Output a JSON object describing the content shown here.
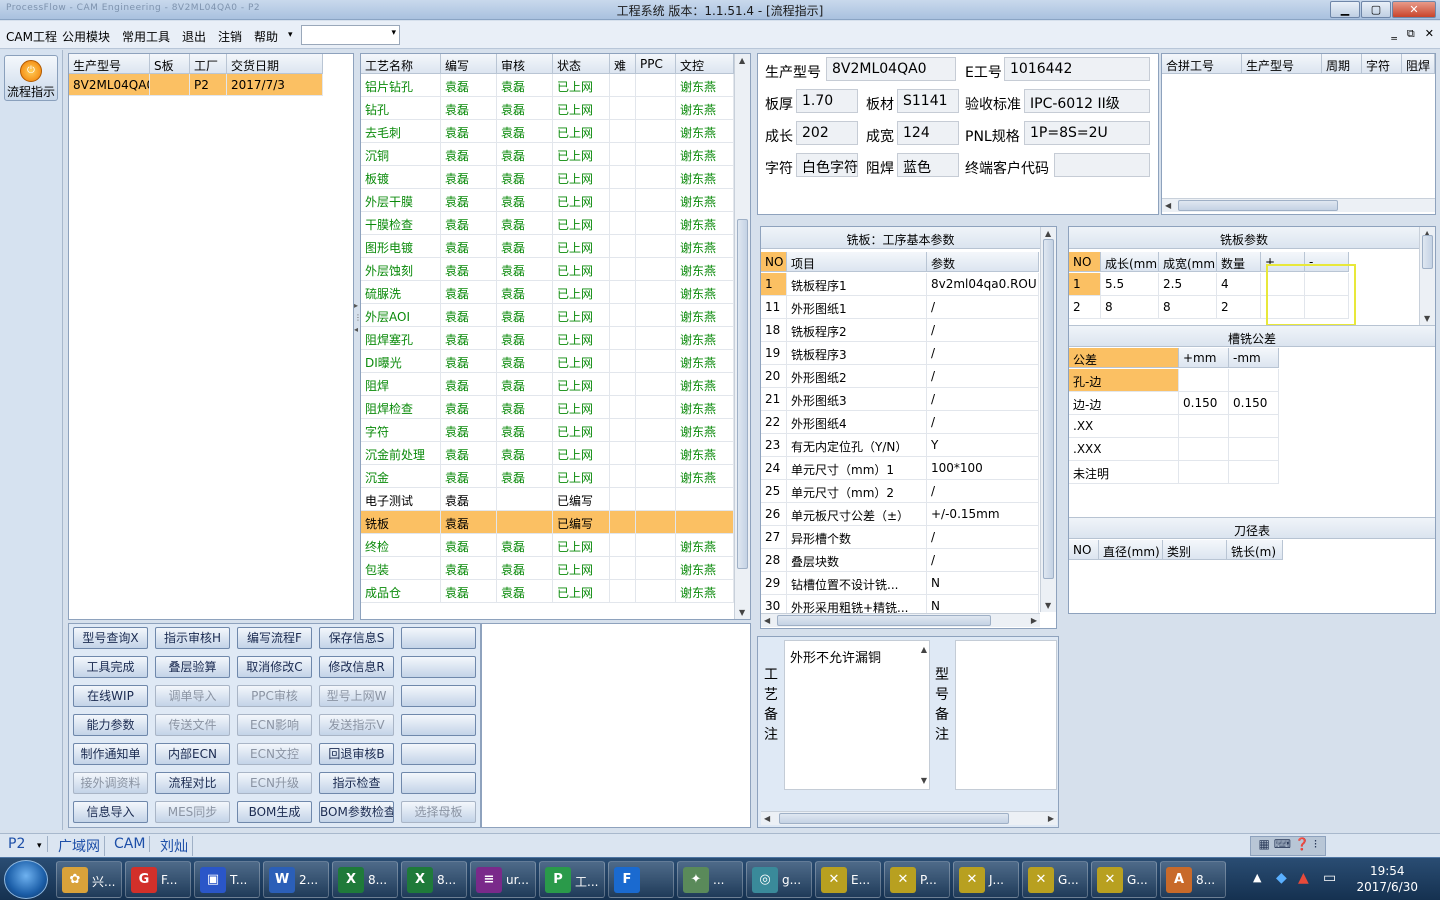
{
  "window": {
    "title": "工程系统   版本：1.1.51.4 - [流程指示]",
    "ghost_title": "ProcessFlow - CAM Engineering - 8V2ML04QA0 - P2"
  },
  "menu": {
    "items": [
      "CAM工程",
      "公用模块",
      "常用工具",
      "退出",
      "注销",
      "帮助"
    ],
    "combo_value": ""
  },
  "side": {
    "flow_button": "流程指示"
  },
  "model_list": {
    "headers": [
      "生产型号",
      "S板",
      "工厂",
      "交货日期"
    ],
    "rows": [
      [
        "8V2ML04QA0",
        "",
        "P2",
        "2017/7/3"
      ]
    ]
  },
  "process": {
    "headers": [
      "工艺名称",
      "编写",
      "审核",
      "状态",
      "难",
      "PPC",
      "文控"
    ],
    "rows": [
      [
        "铝片钻孔",
        "袁磊",
        "袁磊",
        "已上网",
        "",
        "",
        "谢东燕"
      ],
      [
        "钻孔",
        "袁磊",
        "袁磊",
        "已上网",
        "",
        "",
        "谢东燕"
      ],
      [
        "去毛刺",
        "袁磊",
        "袁磊",
        "已上网",
        "",
        "",
        "谢东燕"
      ],
      [
        "沉铜",
        "袁磊",
        "袁磊",
        "已上网",
        "",
        "",
        "谢东燕"
      ],
      [
        "板镀",
        "袁磊",
        "袁磊",
        "已上网",
        "",
        "",
        "谢东燕"
      ],
      [
        "外层干膜",
        "袁磊",
        "袁磊",
        "已上网",
        "",
        "",
        "谢东燕"
      ],
      [
        "干膜检查",
        "袁磊",
        "袁磊",
        "已上网",
        "",
        "",
        "谢东燕"
      ],
      [
        "图形电镀",
        "袁磊",
        "袁磊",
        "已上网",
        "",
        "",
        "谢东燕"
      ],
      [
        "外层蚀刻",
        "袁磊",
        "袁磊",
        "已上网",
        "",
        "",
        "谢东燕"
      ],
      [
        "硫脲洗",
        "袁磊",
        "袁磊",
        "已上网",
        "",
        "",
        "谢东燕"
      ],
      [
        "外层AOI",
        "袁磊",
        "袁磊",
        "已上网",
        "",
        "",
        "谢东燕"
      ],
      [
        "阻焊塞孔",
        "袁磊",
        "袁磊",
        "已上网",
        "",
        "",
        "谢东燕"
      ],
      [
        "DI曝光",
        "袁磊",
        "袁磊",
        "已上网",
        "",
        "",
        "谢东燕"
      ],
      [
        "阻焊",
        "袁磊",
        "袁磊",
        "已上网",
        "",
        "",
        "谢东燕"
      ],
      [
        "阻焊检查",
        "袁磊",
        "袁磊",
        "已上网",
        "",
        "",
        "谢东燕"
      ],
      [
        "字符",
        "袁磊",
        "袁磊",
        "已上网",
        "",
        "",
        "谢东燕"
      ],
      [
        "沉金前处理",
        "袁磊",
        "袁磊",
        "已上网",
        "",
        "",
        "谢东燕"
      ],
      [
        "沉金",
        "袁磊",
        "袁磊",
        "已上网",
        "",
        "",
        "谢东燕"
      ],
      [
        "电子测试",
        "袁磊",
        "",
        "已编写",
        "",
        "",
        ""
      ],
      [
        "铣板",
        "袁磊",
        "",
        "已编写",
        "",
        "",
        ""
      ],
      [
        "终检",
        "袁磊",
        "袁磊",
        "已上网",
        "",
        "",
        "谢东燕"
      ],
      [
        "包装",
        "袁磊",
        "袁磊",
        "已上网",
        "",
        "",
        "谢东燕"
      ],
      [
        "成品仓",
        "袁磊",
        "袁磊",
        "已上网",
        "",
        "",
        "谢东燕"
      ]
    ],
    "selected_index": 19
  },
  "buttons": [
    [
      "型号查询X",
      "指示审核H",
      "编写流程F",
      "保存信息S",
      ""
    ],
    [
      "工具完成",
      "叠层验算",
      "取消修改C",
      "修改信息R",
      ""
    ],
    [
      "在线WIP",
      "调单导入",
      "PPC审核",
      "型号上网W",
      ""
    ],
    [
      "能力参数",
      "传送文件",
      "ECN影响",
      "发送指示V",
      ""
    ],
    [
      "制作通知单",
      "内部ECN",
      "ECN文控",
      "回退审核B",
      ""
    ],
    [
      "接外调资料",
      "流程对比",
      "ECN升级",
      "指示检查",
      ""
    ],
    [
      "信息导入",
      "MES同步",
      "BOM生成",
      "BOM参数检查",
      "选择母板"
    ]
  ],
  "buttons_disabled": [
    [
      false,
      false,
      false,
      false,
      false
    ],
    [
      false,
      false,
      false,
      false,
      false
    ],
    [
      false,
      true,
      true,
      true,
      false
    ],
    [
      false,
      true,
      true,
      true,
      false
    ],
    [
      false,
      false,
      true,
      false,
      false
    ],
    [
      true,
      false,
      true,
      false,
      false
    ],
    [
      false,
      true,
      false,
      false,
      true
    ]
  ],
  "info": {
    "model_label": "生产型号",
    "model": "8V2ML04QA0",
    "eno_label": "E工号",
    "eno": "1016442",
    "thick_label": "板厚",
    "thick": "1.70",
    "mat_label": "板材",
    "mat": "S1141",
    "std_label": "验收标准",
    "std": "IPC-6012 II级",
    "len_label": "成长",
    "len": "202",
    "wid_label": "成宽",
    "wid": "124",
    "pnl_label": "PNL规格",
    "pnl": "1P=8S=2U",
    "char_label": "字符",
    "char": "白色字符",
    "mask_label": "阻焊",
    "mask": "蓝色",
    "cust_label": "终端客户代码",
    "cust": ""
  },
  "combine": {
    "headers": [
      "合拼工号",
      "生产型号",
      "周期",
      "字符",
      "阻焊"
    ]
  },
  "mill_basic": {
    "title": "铣板：工序基本参数",
    "headers": [
      "NO",
      "项目",
      "参数"
    ],
    "rows": [
      [
        "1",
        "铣板程序1",
        "8v2ml04qa0.ROU"
      ],
      [
        "11",
        "外形图纸1",
        "/"
      ],
      [
        "18",
        "铣板程序2",
        "/"
      ],
      [
        "19",
        "铣板程序3",
        "/"
      ],
      [
        "20",
        "外形图纸2",
        "/"
      ],
      [
        "21",
        "外形图纸3",
        "/"
      ],
      [
        "22",
        "外形图纸4",
        "/"
      ],
      [
        "23",
        "有无内定位孔（Y/N）",
        "Y"
      ],
      [
        "24",
        "单元尺寸（mm）1",
        "100*100"
      ],
      [
        "25",
        "单元尺寸（mm）2",
        "/"
      ],
      [
        "26",
        "单元板尺寸公差（±）",
        "+/-0.15mm"
      ],
      [
        "27",
        "异形槽个数",
        "/"
      ],
      [
        "28",
        "叠层块数",
        "/"
      ],
      [
        "29",
        "钻槽位置不设计铣...",
        "N"
      ],
      [
        "30",
        "外形采用粗铣+精铣...",
        "N"
      ]
    ]
  },
  "mill_params": {
    "title": "铣板参数",
    "headers": [
      "NO",
      "成长(mm)",
      "成宽(mm)",
      "数量",
      "+",
      "-"
    ],
    "rows": [
      [
        "1",
        "5.5",
        "2.5",
        "4",
        "",
        ""
      ],
      [
        "2",
        "8",
        "8",
        "2",
        "",
        ""
      ]
    ]
  },
  "slot_tol": {
    "title": "槽铣公差",
    "headers": [
      "公差",
      "+mm",
      "-mm"
    ],
    "rows": [
      [
        "孔-边",
        "",
        ""
      ],
      [
        "边-边",
        "0.150",
        "0.150"
      ],
      [
        ".XX",
        "",
        ""
      ],
      [
        ".XXX",
        "",
        ""
      ],
      [
        "未注明",
        "",
        ""
      ]
    ]
  },
  "cutter": {
    "title": "刀径表",
    "headers": [
      "NO",
      "直径(mm)",
      "类别",
      "铣长(m)"
    ]
  },
  "remarks": {
    "process_label": "工艺备注",
    "process_text": "外形不允许漏铜",
    "model_label": "型号备注",
    "model_text": ""
  },
  "status": {
    "items": [
      "P2",
      "广域网",
      "CAM",
      "刘灿"
    ]
  },
  "taskbar": {
    "items": [
      {
        "label": "兴...",
        "icon": "✿",
        "color": "#d9a23a"
      },
      {
        "label": "F...",
        "icon": "G",
        "color": "#d2302a"
      },
      {
        "label": "T...",
        "icon": "▣",
        "color": "#2a56c8"
      },
      {
        "label": "2...",
        "icon": "W",
        "color": "#2b5fb8"
      },
      {
        "label": "8...",
        "icon": "X",
        "color": "#1f7a3a"
      },
      {
        "label": "8...",
        "icon": "X",
        "color": "#1f7a3a"
      },
      {
        "label": "ur...",
        "icon": "≡",
        "color": "#7a2a8a"
      },
      {
        "label": "工...",
        "icon": "P",
        "color": "#2a9a4a"
      },
      {
        "label": "",
        "icon": "F",
        "color": "#1a6ad0"
      },
      {
        "label": "...",
        "icon": "✦",
        "color": "#5a8a5a"
      },
      {
        "label": "g...",
        "icon": "◎",
        "color": "#3a8a9a"
      },
      {
        "label": "E...",
        "icon": "✕",
        "color": "#b8a020"
      },
      {
        "label": "P...",
        "icon": "✕",
        "color": "#b8a020"
      },
      {
        "label": "J...",
        "icon": "✕",
        "color": "#b8a020"
      },
      {
        "label": "G...",
        "icon": "✕",
        "color": "#b8a020"
      },
      {
        "label": "G...",
        "icon": "✕",
        "color": "#b8a020"
      },
      {
        "label": "8...",
        "icon": "A",
        "color": "#c86a2a"
      }
    ],
    "time": "19:54",
    "date": "2017/6/30"
  },
  "colors": {
    "accent_select": "#fbc063",
    "status_green": "#0a8a0a",
    "highlight_box": "#e8e83a"
  }
}
